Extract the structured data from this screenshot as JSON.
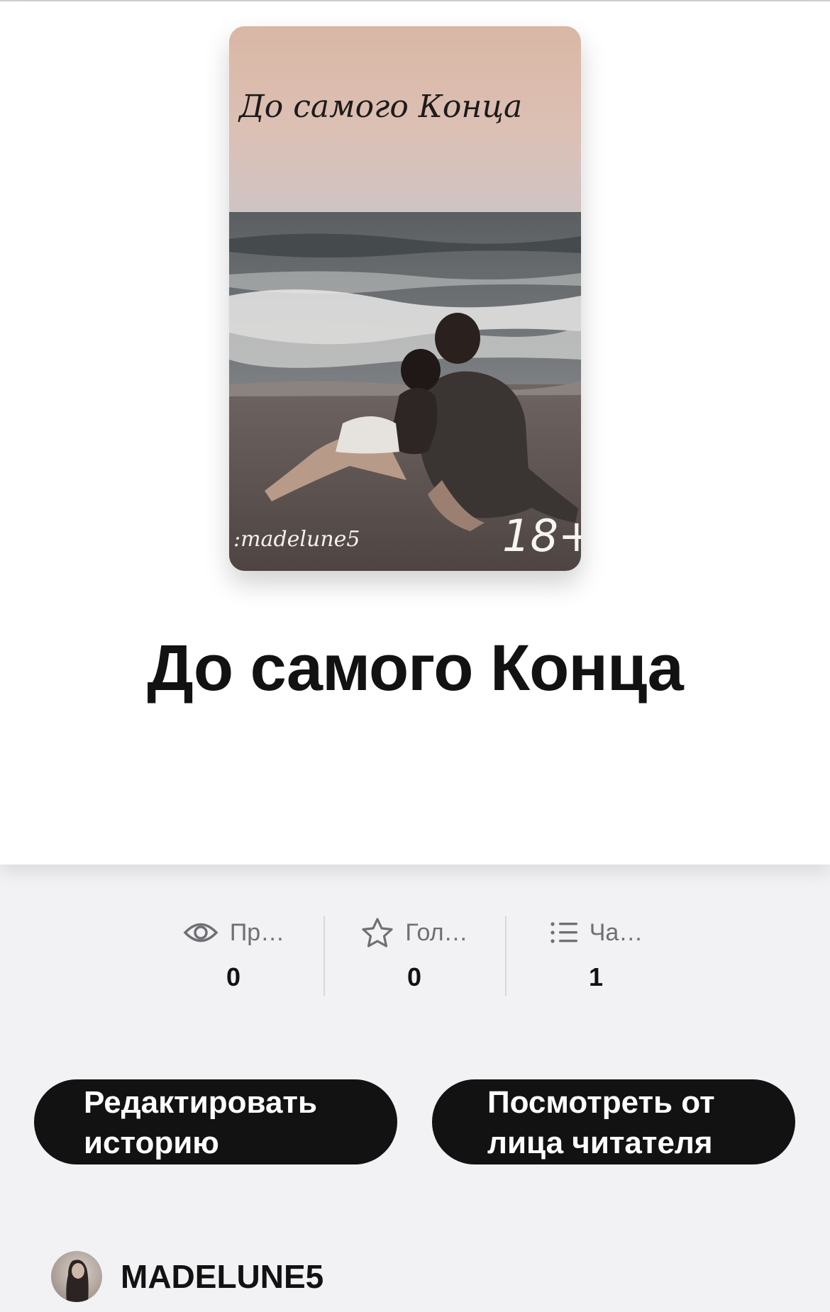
{
  "story": {
    "title": "До самого Конца",
    "cover": {
      "title_text": "До самого Конца",
      "author_text": ":madelune5",
      "rating_text": "18+"
    }
  },
  "stats": [
    {
      "label": "Пр…",
      "value": "0",
      "icon": "eye-icon"
    },
    {
      "label": "Гол…",
      "value": "0",
      "icon": "star-icon"
    },
    {
      "label": "Ча…",
      "value": "1",
      "icon": "list-icon"
    }
  ],
  "buttons": {
    "edit": {
      "line1": "Редактировать",
      "line2": "историю"
    },
    "reader_view": {
      "line1": "Посмотреть от",
      "line2": "лица читателя"
    }
  },
  "author": {
    "name": "MADELUNE5"
  },
  "colors": {
    "button_bg": "#121212",
    "page_bg": "#f2f1f4",
    "hero_bg": "#ffffff",
    "muted_text": "#6f6f74"
  }
}
